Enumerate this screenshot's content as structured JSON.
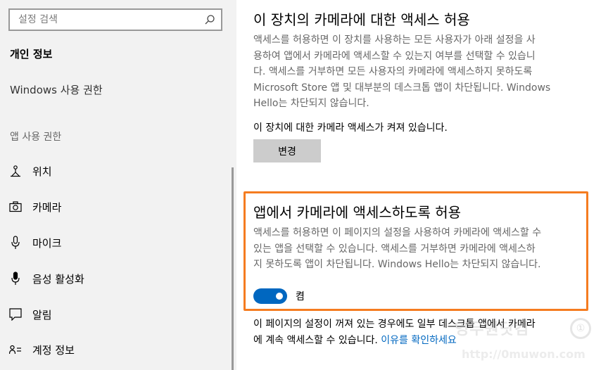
{
  "sidebar": {
    "search_placeholder": "설정 검색",
    "heading": "개인 정보",
    "windows_permissions": "Windows 사용 권한",
    "app_permissions_section": "앱 사용 권한",
    "items": [
      {
        "label": "위치",
        "icon": "location-icon"
      },
      {
        "label": "카메라",
        "icon": "camera-icon"
      },
      {
        "label": "마이크",
        "icon": "microphone-icon"
      },
      {
        "label": "음성 활성화",
        "icon": "voice-activation-icon"
      },
      {
        "label": "알림",
        "icon": "notifications-icon"
      },
      {
        "label": "계정 정보",
        "icon": "account-info-icon"
      }
    ]
  },
  "main": {
    "device_section_title": "이 장치의 카메라에 대한 액세스 허용",
    "device_desc_lines": [
      "액세스를 허용하면 이 장치를 사용하는 모든 사용자가 아래 설정을 사",
      "용하여 앱에서 카메라에 액세스할 수 있는지 여부를 선택할 수 있습니",
      "다. 액세스를 거부하면 모든 사용자의 카메라에 액세스하지 못하도록",
      "Microsoft Store 앱 및 대부분의 데스크톱 앱이 차단됩니다. Windows",
      "Hello는 차단되지 않습니다."
    ],
    "device_status": "이 장치에 대한 카메라 액세스가 켜져 있습니다.",
    "change_button": "변경",
    "app_section_title": "앱에서 카메라에 액세스하도록 허용",
    "app_desc_lines": [
      "액세스를 허용하면 이 페이지의 설정을 사용하여 카메라에 액세스할 수",
      "있는 앱을 선택할 수 있습니다. 액세스를 거부하면 카메라에 액세스하",
      "지 못하도록 앱이 차단됩니다. Windows Hello는 차단되지 않습니다."
    ],
    "toggle_state": "켬",
    "toggle_on": true,
    "footer_line1": "이 페이지의 설정이 꺼져 있는 경우에도 일부 데스크톱 앱에서 카메라",
    "footer_line2": "에 계속 액세스할 수 있습니다.",
    "footer_link": "이유를 확인하세요"
  },
  "watermark": {
    "text": "영무원닷컴",
    "url": "http://0muwon.com",
    "logo": "①"
  },
  "colors": {
    "accent": "#0067c0",
    "highlight": "#f57c20",
    "sidebar_bg": "#f2f2f2",
    "button_bg": "#cccccc"
  }
}
